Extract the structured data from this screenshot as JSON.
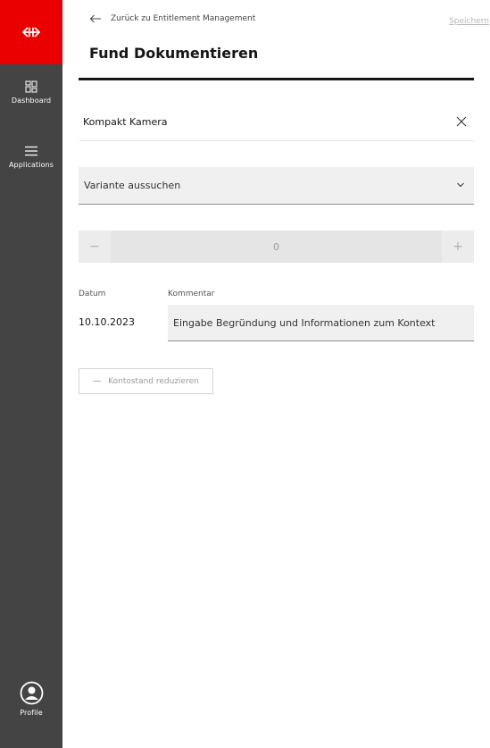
{
  "sidebar": {
    "logo_icon": "sbb-logo-icon",
    "items": [
      {
        "label": "Dashboard",
        "icon": "dashboard-icon"
      },
      {
        "label": "Applications",
        "icon": "hamburger-menu-icon"
      }
    ],
    "profile": {
      "label": "Profile",
      "icon": "user-circle-icon"
    }
  },
  "header": {
    "back_label": "Zurück zu Entitlement Management",
    "save_label": "Speichern",
    "title": "Fund Dokumentieren"
  },
  "form": {
    "item_name": "Kompakt Kamera",
    "variant_placeholder": "Variante aussuchen",
    "quantity": "0",
    "quantity_minus": "−",
    "quantity_plus": "+",
    "datum_label": "Datum",
    "datum_value": "10.10.2023",
    "kommentar_label": "Kommentar",
    "kommentar_placeholder": "Eingabe Begründung und Informationen zum Kontext",
    "reduce_button_label": "Kontostand reduzieren"
  },
  "colors": {
    "brand_red": "#eb0000",
    "sidebar_bg": "#444444"
  }
}
